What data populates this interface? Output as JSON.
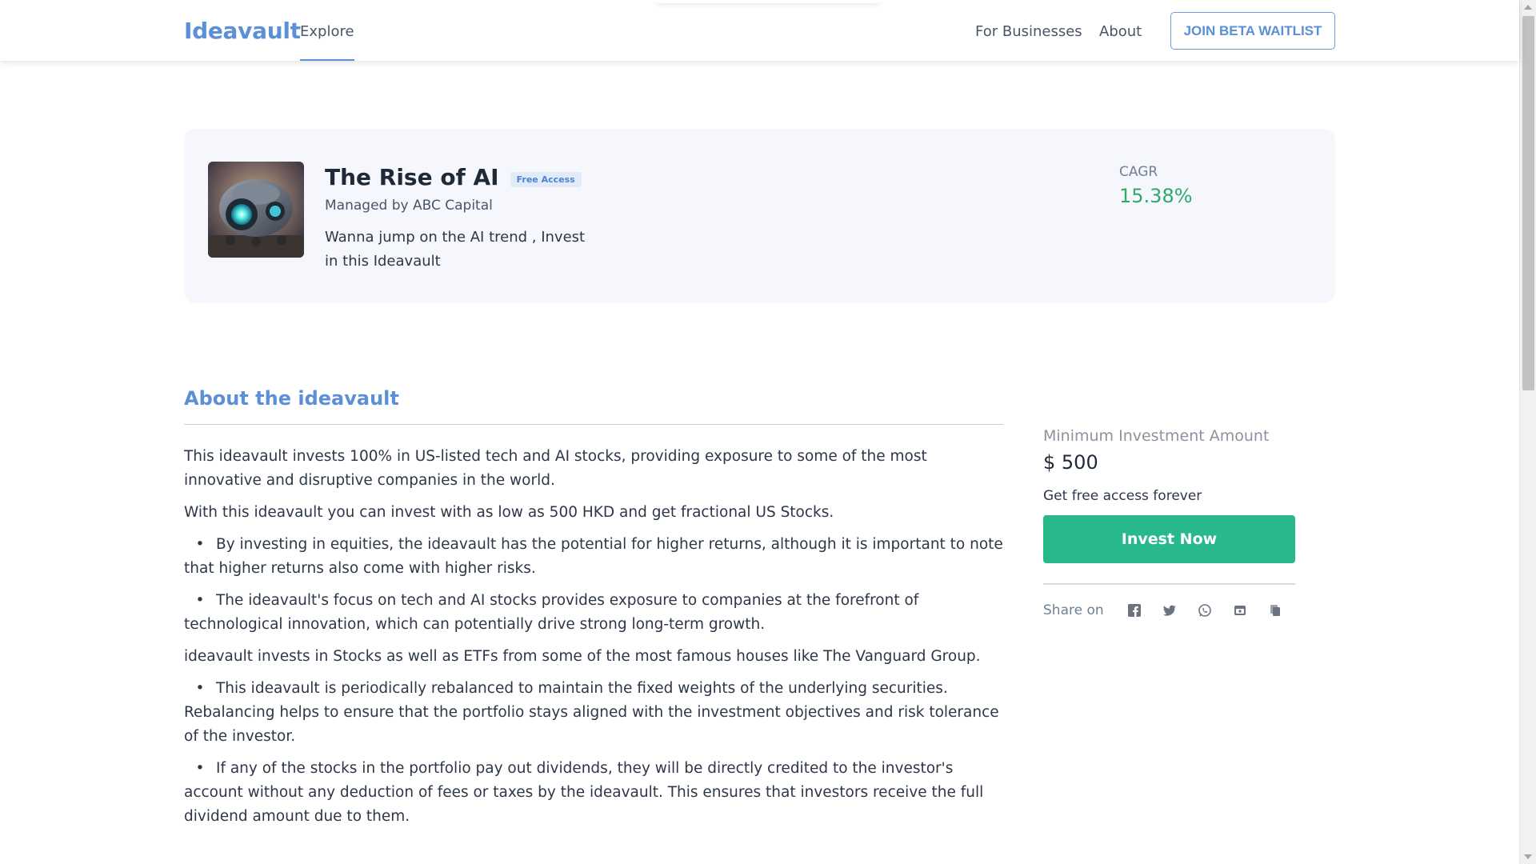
{
  "nav": {
    "brand": "Ideavault",
    "explore": "Explore",
    "for_businesses": "For Businesses",
    "about": "About",
    "join_waitlist": "JOIN BETA WAITLIST"
  },
  "hero": {
    "title": "The Rise of AI",
    "badge": "Free Access",
    "manager": "Managed by ABC Capital",
    "description": "Wanna jump on the AI trend , Invest in this Ideavault",
    "cagr_label": "CAGR",
    "cagr_value": "15.38%"
  },
  "about": {
    "title": "About the ideavault",
    "p1": "This ideavault invests 100% in US-listed tech and AI stocks, providing exposure to some of the most innovative and disruptive companies in the world.",
    "p2": "With this ideavault you can invest with as low as 500 HKD and get fractional US Stocks.",
    "b1": "By investing in equities, the ideavault has the potential for higher returns, although it is important to note that higher returns also come with higher risks.",
    "b2": "The ideavault's focus on tech and AI stocks provides exposure to companies at the forefront of technological innovation, which can potentially drive strong long-term growth.",
    "p3": "ideavault invests in Stocks as well as ETFs from some of the most famous houses like The Vanguard Group.",
    "b3": "This ideavault is periodically rebalanced to maintain the fixed weights of the underlying securities. Rebalancing helps to ensure that the portfolio stays aligned with the investment objectives and risk tolerance of the investor.",
    "b4": "If any of the stocks in the portfolio pay out dividends, they will be directly credited to the investor's account without any deduction of fees or taxes by the ideavault. This ensures that investors receive the full dividend amount due to them.",
    "bullet_char": "•"
  },
  "invest": {
    "min_label": "Minimum Investment Amount",
    "min_value": "$ 500",
    "free_text": "Get free access forever",
    "button": "Invest Now",
    "share_label": "Share on",
    "share_icons": [
      "facebook-icon",
      "twitter-icon",
      "whatsapp-icon",
      "email-icon",
      "copy-icon"
    ]
  },
  "colors": {
    "brand_blue": "#5b8fd6",
    "cagr_green": "#2faa6a",
    "invest_green": "#27b98b",
    "hero_bg": "#f5f7fc"
  }
}
